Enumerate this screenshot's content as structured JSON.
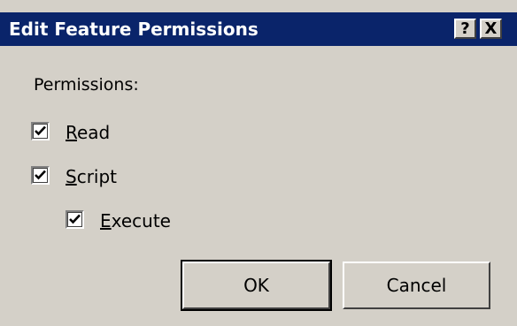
{
  "window": {
    "title": "Edit Feature Permissions",
    "help_button": "?",
    "close_button": "X"
  },
  "permissions": {
    "heading": "Permissions:",
    "items": [
      {
        "access_key": "R",
        "label_rest": "ead",
        "checked": true
      },
      {
        "access_key": "S",
        "label_rest": "cript",
        "checked": true
      },
      {
        "access_key": "E",
        "label_rest": "xecute",
        "checked": true
      }
    ]
  },
  "buttons": {
    "ok": "OK",
    "cancel": "Cancel"
  },
  "colors": {
    "titlebar": "#0a246a",
    "dialog_background": "#d4d0c8"
  }
}
